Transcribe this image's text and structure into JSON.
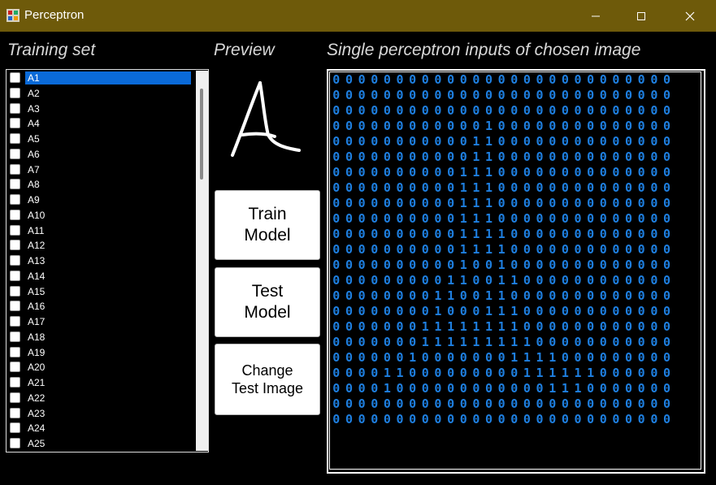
{
  "window": {
    "title": "Perceptron",
    "titlebar_color": "#6e5a0a",
    "controls": [
      "minimize-icon",
      "maximize-icon",
      "close-icon"
    ]
  },
  "training_set": {
    "heading": "Training set",
    "selected_index": 0,
    "items": [
      "A1",
      "A2",
      "A3",
      "A4",
      "A5",
      "A6",
      "A7",
      "A8",
      "A9",
      "A10",
      "A11",
      "A12",
      "A13",
      "A14",
      "A15",
      "A16",
      "A17",
      "A18",
      "A19",
      "A20",
      "A21",
      "A22",
      "A23",
      "A24",
      "A25"
    ]
  },
  "preview": {
    "heading": "Preview"
  },
  "buttons": {
    "train": "Train\nModel",
    "test": "Test\nModel",
    "change": "Change\nTest Image"
  },
  "inputs": {
    "heading": "Single perceptron inputs of chosen image",
    "digit_color": "#1e7fe0",
    "rows": [
      "000000000000000000000000000",
      "000000000000000000000000000",
      "000000000000000000000000000",
      "000000000000100000000000000",
      "000000000001100000000000000",
      "000000000001100000000000000",
      "000000000011100000000000000",
      "000000000011100000000000000",
      "000000000011100000000000000",
      "000000000011100000000000000",
      "000000000011110000000000000",
      "000000000011110000000000000",
      "000000000010010000000000000",
      "000000000110011000000000000",
      "000000001100110000000000000",
      "000000001000111000000000000",
      "000000011111111000000000000",
      "000000011111111100000000000",
      "000000100000001111000000000",
      "000011000000000111111000000",
      "000010000000000001110000000",
      "000000000000000000000000000",
      "000000000000000000000000000"
    ]
  }
}
